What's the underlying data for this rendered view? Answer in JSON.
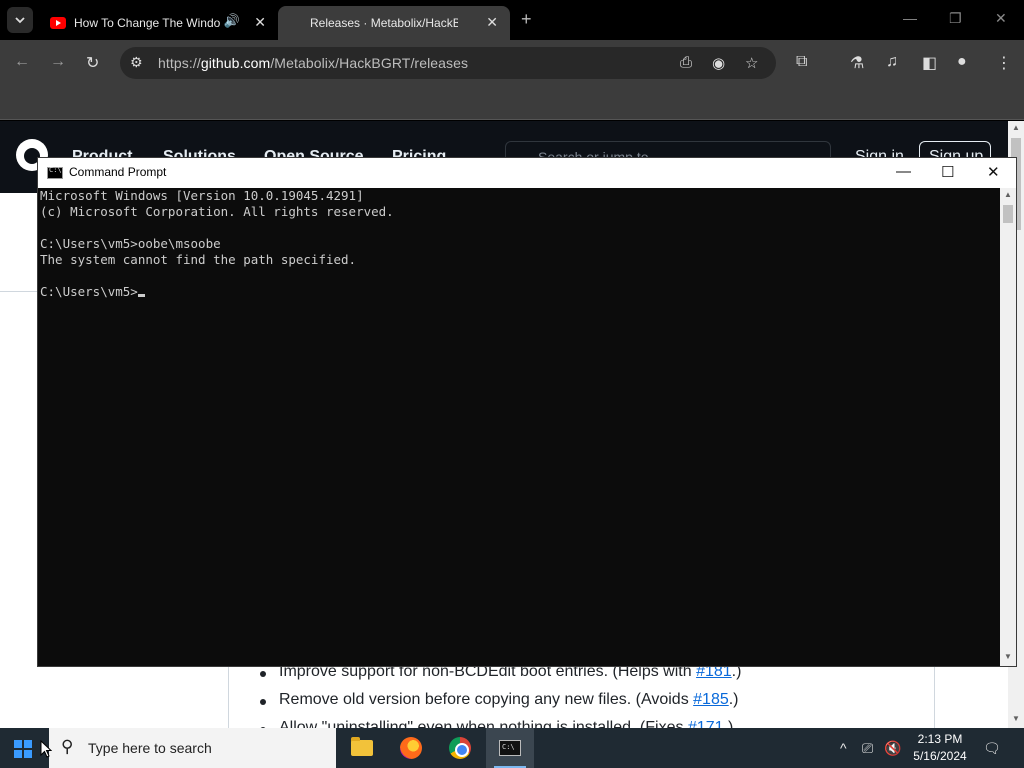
{
  "browser": {
    "tabs": [
      {
        "title": "How To Change The Windo",
        "active": false,
        "audio": true
      },
      {
        "title": "Releases · Metabolix/HackBGRT",
        "active": true,
        "audio": false
      }
    ],
    "address": {
      "prefix": "https://",
      "domain": "github.com",
      "path": "/Metabolix/HackBGRT/releases"
    }
  },
  "page": {
    "nav": [
      "Product",
      "Solutions",
      "Open Source",
      "Pricing"
    ],
    "search_placeholder": "Search or jump to...",
    "signin": "Sign in",
    "signup": "Sign up",
    "release_notes": [
      {
        "text_before": "Improve support for non-BCDEdit boot entries. (Helps with ",
        "link": "#181",
        "text_after": ".)"
      },
      {
        "text_before": "Remove old version before copying any new files. (Avoids ",
        "link": "#185",
        "text_after": ".)"
      },
      {
        "text_before": "Allow \"uninstalling\" even when nothing is installed. (Fixes ",
        "link": "#171",
        "text_after": ".)"
      }
    ]
  },
  "cmd": {
    "title": "Command Prompt",
    "lines": [
      "Microsoft Windows [Version 10.0.19045.4291]",
      "(c) Microsoft Corporation. All rights reserved.",
      "",
      "C:\\Users\\vm5>oobe\\msoobe",
      "The system cannot find the path specified.",
      "",
      "C:\\Users\\vm5>"
    ]
  },
  "taskbar": {
    "search_placeholder": "Type here to search",
    "apps": [
      "file-explorer",
      "firefox",
      "chrome",
      "command-prompt"
    ],
    "time": "2:13 PM",
    "date": "5/16/2024"
  }
}
